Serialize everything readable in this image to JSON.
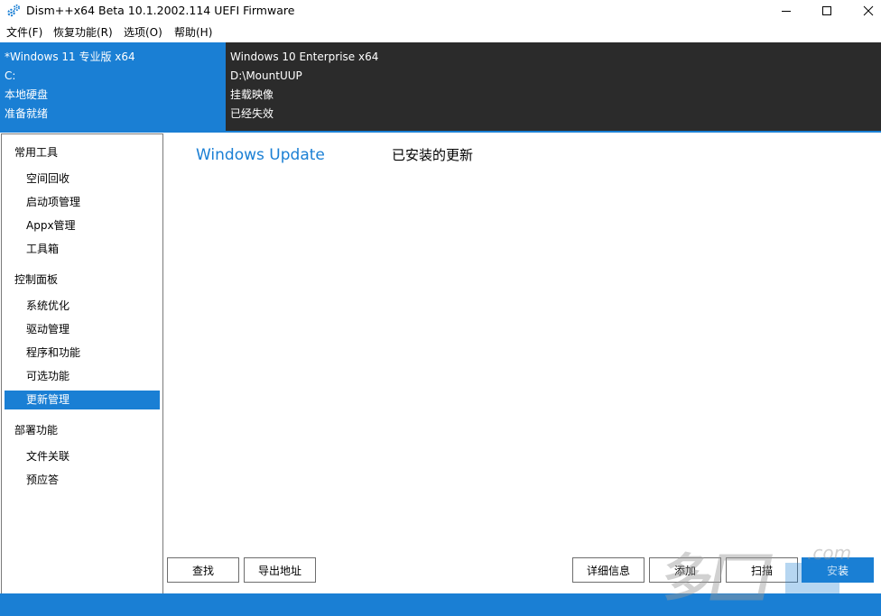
{
  "window": {
    "title": "Dism++x64 Beta 10.1.2002.114 UEFI Firmware",
    "accent_color": "#1a7fd4",
    "dark_color": "#2b2b2b"
  },
  "menu": {
    "items": [
      "文件(F)",
      "恢复功能(R)",
      "选项(O)",
      "帮助(H)"
    ]
  },
  "session_left": {
    "name": "*Windows 11 专业版 x64",
    "drive": "C:",
    "type": "本地硬盘",
    "status": "准备就绪"
  },
  "session_right": {
    "name": "Windows 10 Enterprise x64",
    "path": "D:\\MountUUP",
    "type": "挂载映像",
    "status": "已经失效"
  },
  "sidebar": {
    "groups": [
      {
        "label": "常用工具",
        "items": [
          "空间回收",
          "启动项管理",
          "Appx管理",
          "工具箱"
        ]
      },
      {
        "label": "控制面板",
        "items": [
          "系统优化",
          "驱动管理",
          "程序和功能",
          "可选功能",
          "更新管理"
        ]
      },
      {
        "label": "部署功能",
        "items": [
          "文件关联",
          "预应答"
        ]
      }
    ],
    "selected": "更新管理"
  },
  "main": {
    "tab_windows_update": "Windows Update",
    "tab_installed": "已安装的更新",
    "buttons": {
      "find": "查找",
      "export": "导出地址",
      "details": "详细信息",
      "add": "添加",
      "scan": "扫描",
      "install": "安装"
    }
  },
  "watermark": {
    "text_main": "多",
    "text_domain": ".com"
  }
}
